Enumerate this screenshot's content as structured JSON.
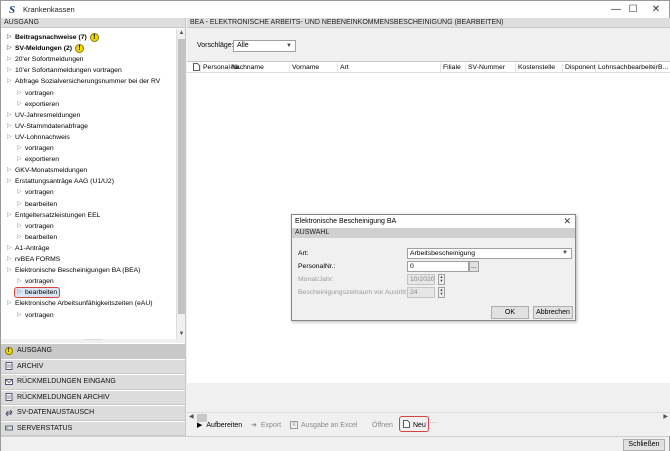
{
  "window": {
    "title": "Krankenkassen",
    "minimize_glyph": "—",
    "maximize_glyph": "☐",
    "close_glyph": "✕"
  },
  "left_panel": {
    "header": "AUSGANG",
    "tree": [
      {
        "label": "Beitragsnachweise (7)",
        "bold": true,
        "warn": true
      },
      {
        "label": "SV-Meldungen (2)",
        "bold": true,
        "warn": true
      },
      {
        "label": "20'er Sofortmeldungen"
      },
      {
        "label": "10'er Sofortanmeldungen vortragen"
      },
      {
        "label": "Abfrage Sozialversicherungsnummer bei der RV"
      },
      {
        "label": "vortragen",
        "child": true
      },
      {
        "label": "exportieren",
        "child": true
      },
      {
        "label": "UV-Jahresmeldungen"
      },
      {
        "label": "UV-Stammdatenabfrage"
      },
      {
        "label": "UV-Lohnnachweis"
      },
      {
        "label": "vortragen",
        "child": true
      },
      {
        "label": "exportieren",
        "child": true
      },
      {
        "label": "GKV-Monatsmeldungen"
      },
      {
        "label": "Erstattungsanträge AAG (U1/U2)"
      },
      {
        "label": "vortragen",
        "child": true
      },
      {
        "label": "bearbeiten",
        "child": true
      },
      {
        "label": "Entgeltersatzleistungen EEL"
      },
      {
        "label": "vortragen",
        "child": true
      },
      {
        "label": "bearbeiten",
        "child": true
      },
      {
        "label": "A1-Anträge"
      },
      {
        "label": "rvBEA FORMS"
      },
      {
        "label": "Elektronische Bescheinigungen BA (BEA)"
      },
      {
        "label": "vortragen",
        "child": true
      },
      {
        "label": "bearbeiten",
        "child": true,
        "selected": true
      },
      {
        "label": "Elektronische Arbeitsunfähigkeitszeiten (eAU)"
      },
      {
        "label": "vortragen",
        "child": true
      }
    ],
    "nav": [
      {
        "label": "AUSGANG",
        "icon": "warning-icon",
        "active": true
      },
      {
        "label": "ARCHIV",
        "icon": "archive-icon"
      },
      {
        "label": "RÜCKMELDUNGEN EINGANG",
        "icon": "inbox-icon"
      },
      {
        "label": "RÜCKMELDUNGEN ARCHIV",
        "icon": "archive-icon"
      },
      {
        "label": "SV-DATENAUSTAUSCH",
        "icon": "exchange-icon"
      },
      {
        "label": "SERVERSTATUS",
        "icon": "server-icon"
      }
    ]
  },
  "main": {
    "header": "BEA - ELEKTRONISCHE ARBEITS- UND NEBENEINKOMMENSBESCHEINIGUNG (BEARBEITEN)",
    "vorschlaege_label": "Vorschläge:",
    "vorschlaege_value": "Alle",
    "columns": [
      "Personal-Nr.",
      "Nachname",
      "Vorname",
      "Art",
      "Filiale",
      "SV-Nummer",
      "Kostenstelle",
      "Disponent",
      "Lohnsachbearbeiter",
      "B..."
    ],
    "toolbar": {
      "aufbereiten": "Aufbereiten",
      "export": "Export",
      "ausgabe_excel": "Ausgabe an Excel",
      "oeffnen": "Öffnen",
      "neu": "Neu"
    }
  },
  "dialog": {
    "title": "Elektronische Bescheinigung BA",
    "section": "AUSWAHL",
    "art_label": "Art:",
    "art_value": "Arbeitsbescheinigung",
    "personalnr_label": "PersonalNr.:",
    "personalnr_value": "0",
    "browse_label": "...",
    "monat_label": "Monat/Jahr:",
    "monat_value": "10/2020",
    "zeitraum_label": "Bescheinigungszeitraum vor Austritt:",
    "zeitraum_value": "24",
    "ok": "OK",
    "abbrechen": "Abbrechen"
  },
  "footer": {
    "schliessen": "Schließen"
  }
}
